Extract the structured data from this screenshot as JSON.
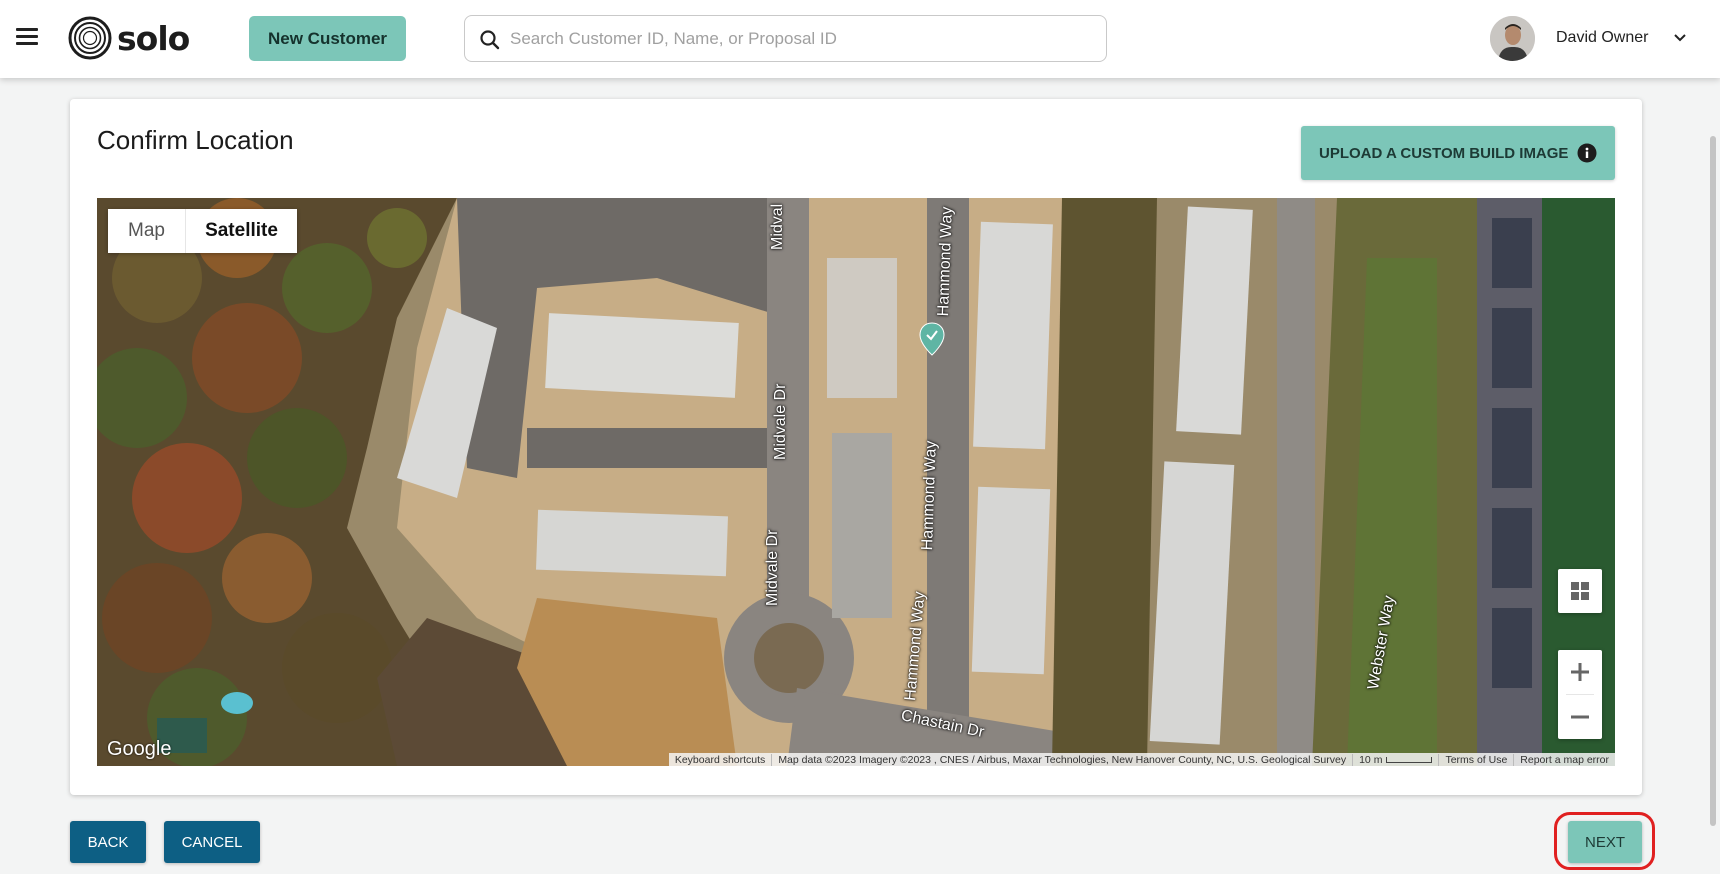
{
  "header": {
    "menu_icon": "hamburger-menu-icon",
    "logo_text": "solo",
    "new_customer_label": "New Customer",
    "search_placeholder": "Search Customer ID, Name, or Proposal ID",
    "search_value": "",
    "user_name": "David Owner"
  },
  "main": {
    "title": "Confirm Location",
    "upload_label": "UPLOAD A CUSTOM BUILD IMAGE"
  },
  "map": {
    "type_map_label": "Map",
    "type_satellite_label": "Satellite",
    "selected_type": "Satellite",
    "google_label": "Google",
    "roads": {
      "midvale_1": "Midval",
      "midvale_2": "Midvale Dr",
      "midvale_3": "Midvale Dr",
      "hammond_1": "Hammond Way",
      "hammond_2": "Hammond Way",
      "hammond_3": "Hammond Way",
      "chastain": "Chastain Dr",
      "webster": "Webster Way"
    },
    "attribution": {
      "keyboard": "Keyboard shortcuts",
      "data": "Map data ©2023 Imagery ©2023 , CNES / Airbus, Maxar Technologies, New Hanover County, NC, U.S. Geological Survey",
      "scale": "10 m",
      "terms": "Terms of Use",
      "report": "Report a map error"
    }
  },
  "footer": {
    "back_label": "BACK",
    "cancel_label": "CANCEL",
    "next_label": "NEXT"
  },
  "colors": {
    "accent": "#7cc6b8",
    "primary": "#0d5f84",
    "highlight_ring": "#e02020"
  }
}
